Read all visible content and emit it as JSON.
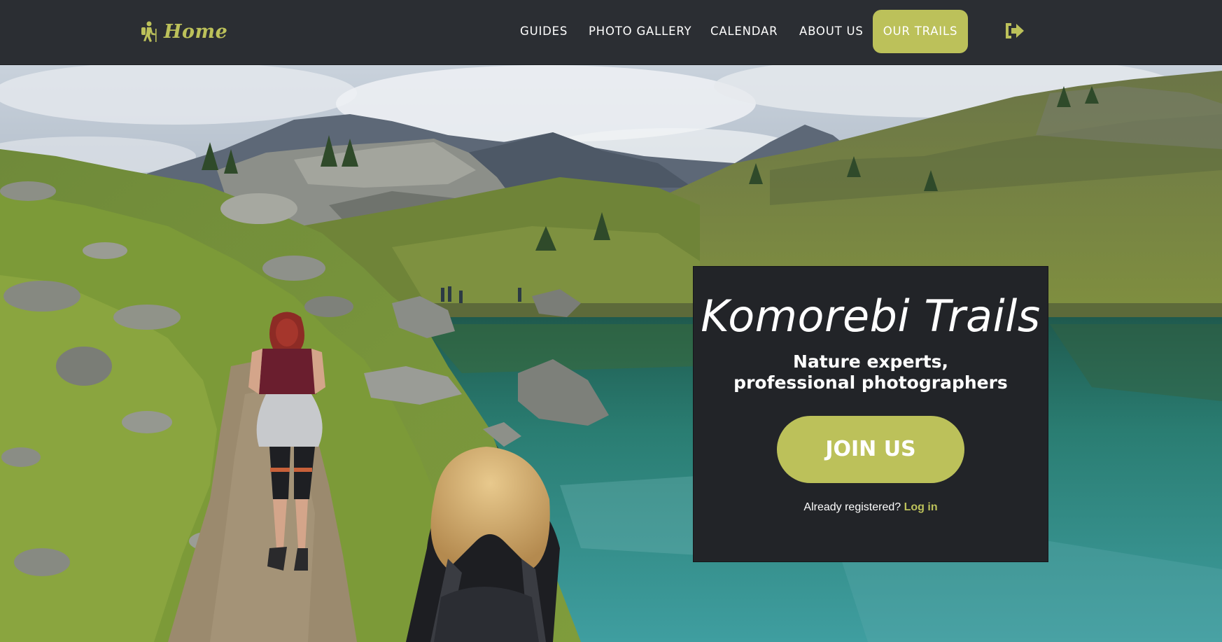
{
  "nav": {
    "brand_label": "Home",
    "brand_icon": "hiker-icon",
    "links": [
      "GUIDES",
      "PHOTO GALLERY",
      "CALENDAR",
      "ABOUT US"
    ],
    "cta_label": "OUR TRAILS",
    "logout_icon": "logout-icon"
  },
  "hero": {
    "title": "Komorebi Trails",
    "subtitle_line1": "Nature experts,",
    "subtitle_line2": "professional photographers",
    "join_label": "JOIN US",
    "login_prompt": "Already registered?",
    "login_link": "Log in"
  },
  "colors": {
    "accent": "#bcc15a",
    "navbar": "#2b2e33",
    "card": "#222428",
    "text": "#ffffff"
  }
}
